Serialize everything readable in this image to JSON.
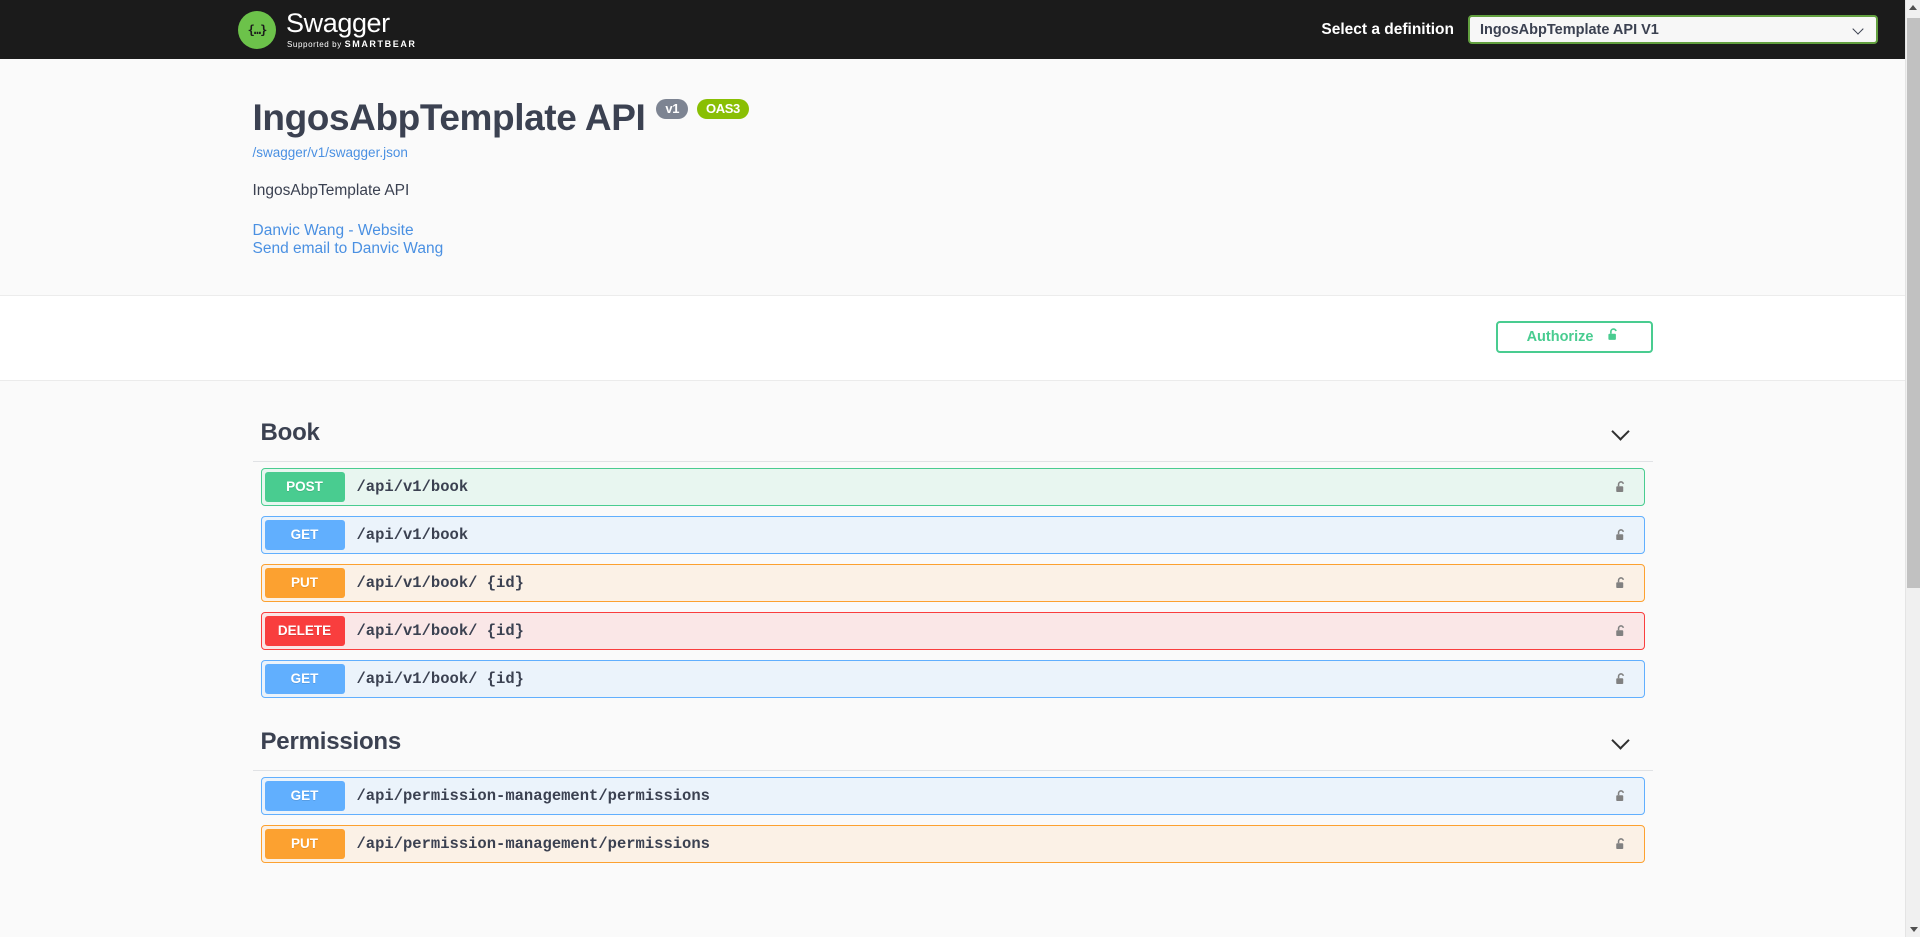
{
  "topbar": {
    "logo_glyph": "{…}",
    "brand_name": "Swagger",
    "brand_trademark": "™",
    "supported_by": "Supported by",
    "supported_brand": "SMARTBEAR",
    "definition_label": "Select a definition",
    "definition_selected": "IngosAbpTemplate API V1"
  },
  "info": {
    "title": "IngosAbpTemplate API",
    "version_badge": "v1",
    "oas_badge": "OAS3",
    "spec_url": "/swagger/v1/swagger.json",
    "description": "IngosAbpTemplate API",
    "website_link": "Danvic Wang - Website",
    "email_link": "Send email to Danvic Wang"
  },
  "authorize": {
    "label": "Authorize",
    "icon": "unlock-icon",
    "accent_color": "#49cc90"
  },
  "tags": [
    {
      "name": "Book",
      "chevron": "chevron-down-icon",
      "operations": [
        {
          "method": "POST",
          "path": "/api/v1/book",
          "lock": "unlock-icon"
        },
        {
          "method": "GET",
          "path": "/api/v1/book",
          "lock": "unlock-icon"
        },
        {
          "method": "PUT",
          "path": "/api/v1/book/ {id}",
          "lock": "unlock-icon"
        },
        {
          "method": "DELETE",
          "path": "/api/v1/book/ {id}",
          "lock": "unlock-icon"
        },
        {
          "method": "GET",
          "path": "/api/v1/book/ {id}",
          "lock": "unlock-icon"
        }
      ]
    },
    {
      "name": "Permissions",
      "chevron": "chevron-down-icon",
      "operations": [
        {
          "method": "GET",
          "path": "/api/permission-management/permissions",
          "lock": "unlock-icon"
        },
        {
          "method": "PUT",
          "path": "/api/permission-management/permissions",
          "lock": "unlock-icon"
        }
      ]
    }
  ],
  "method_colors": {
    "POST": "#49cc90",
    "GET": "#61affe",
    "PUT": "#fca130",
    "DELETE": "#f93e3e"
  }
}
